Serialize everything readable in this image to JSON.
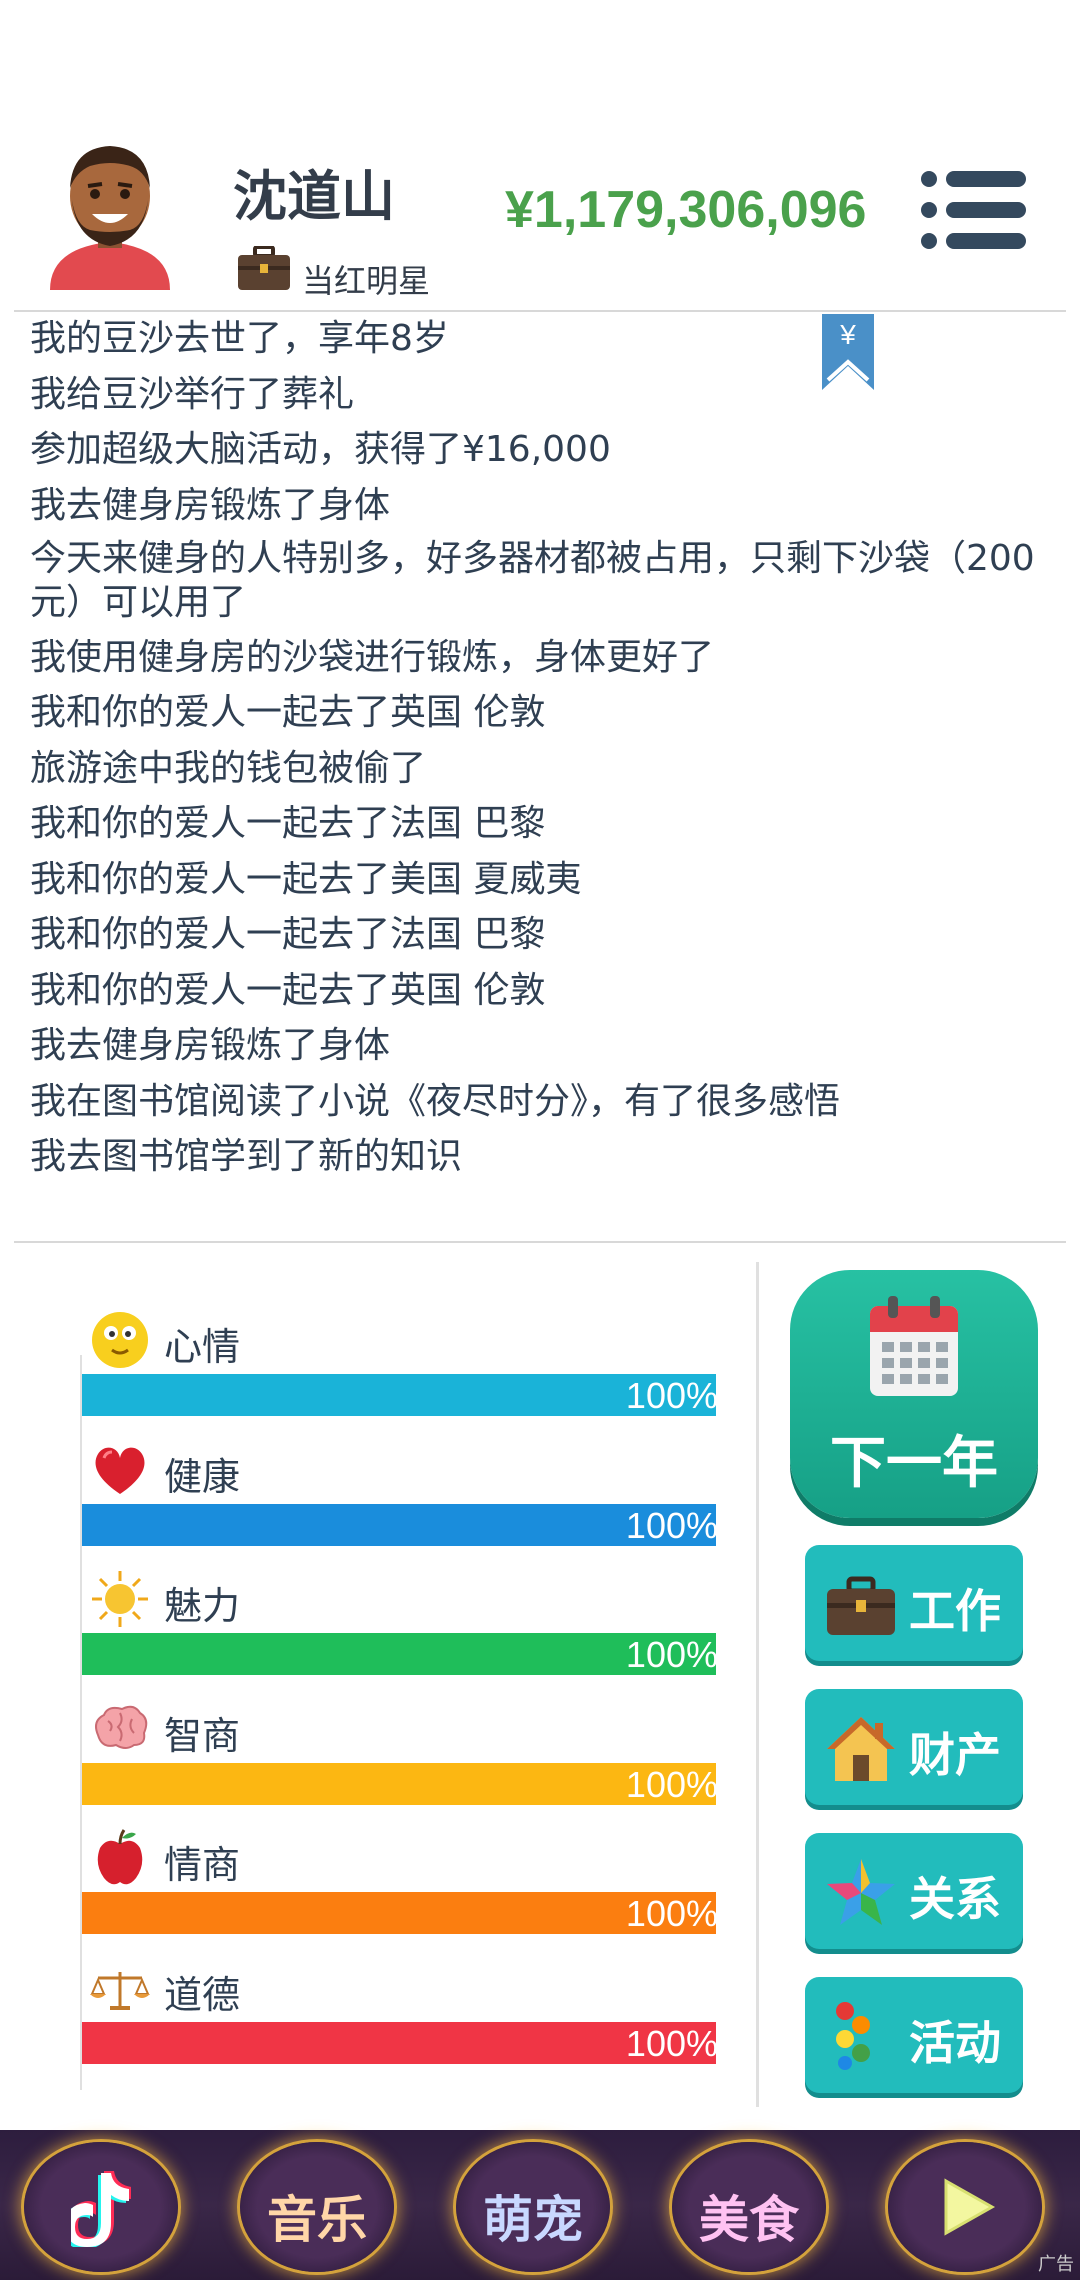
{
  "header": {
    "name": "沈道山",
    "job": "当红明星",
    "money": "¥1,179,306,096"
  },
  "bookmark_symbol": "¥",
  "log": [
    "我的豆沙去世了，享年8岁",
    "我给豆沙举行了葬礼",
    "参加超级大脑活动，获得了¥16,000",
    "我去健身房锻炼了身体",
    "今天来健身的人特别多，好多器材都被占用，只剩下沙袋（200元）可以用了",
    "我使用健身房的沙袋进行锻炼，身体更好了",
    "我和你的爱人一起去了英国 伦敦",
    "旅游途中我的钱包被偷了",
    "我和你的爱人一起去了法国 巴黎",
    "我和你的爱人一起去了美国 夏威夷",
    "我和你的爱人一起去了法国 巴黎",
    "我和你的爱人一起去了英国 伦敦",
    "我去健身房锻炼了身体",
    "我在图书馆阅读了小说《夜尽时分》，有了很多感悟",
    "我去图书馆学到了新的知识"
  ],
  "stats": [
    {
      "label": "心情",
      "value": "100%",
      "fraction": 1.0,
      "color": "#1ab3d8",
      "icon": "smiley-icon"
    },
    {
      "label": "健康",
      "value": "100%",
      "fraction": 1.0,
      "color": "#1a8ddc",
      "icon": "heart-icon"
    },
    {
      "label": "魅力",
      "value": "100%",
      "fraction": 1.0,
      "color": "#1fbe5a",
      "icon": "sun-icon"
    },
    {
      "label": "智商",
      "value": "100%",
      "fraction": 1.0,
      "color": "#fcb712",
      "icon": "brain-icon"
    },
    {
      "label": "情商",
      "value": "100%",
      "fraction": 1.0,
      "color": "#fb7e10",
      "icon": "apple-icon"
    },
    {
      "label": "道德",
      "value": "100%",
      "fraction": 1.0,
      "color": "#f03545",
      "icon": "scales-icon"
    }
  ],
  "actions": {
    "next_year": "下一年",
    "work": "工作",
    "property": "财产",
    "relations": "关系",
    "activities": "活动"
  },
  "bottom_bar": {
    "music": "音乐",
    "pets": "萌宠",
    "food": "美食",
    "ad": "广告"
  },
  "colors": {
    "money": "#4aa14c",
    "text": "#2f3f52",
    "action": "#22bcbc",
    "next_year": "#1ab394"
  }
}
